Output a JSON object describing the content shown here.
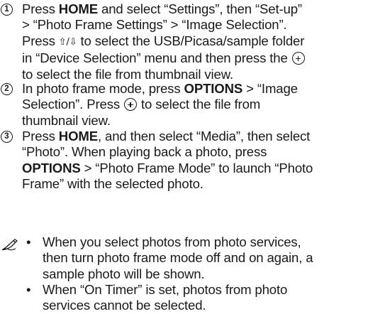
{
  "steps": [
    {
      "number": "1",
      "lines": [
        {
          "a": "Press ",
          "b": "HOME",
          "c": " and select “Settings”, then “Set-up”"
        },
        {
          "a": "> “Photo Frame Settings” > “Image Selection”."
        },
        {
          "a": "Press ",
          "arrows": "⇧/⇩",
          "c": " to select the USB/Picasa/sample folder"
        },
        {
          "a": "in “Device Selection” menu and then press the"
        },
        {
          "a": "to select the file from thumbnail view."
        }
      ]
    },
    {
      "number": "2",
      "lines": [
        {
          "a": "In photo frame mode, press ",
          "b": "OPTIONS",
          "c": " > “Image"
        },
        {
          "a": "Selection”. Press ",
          "c": " to select the file from"
        },
        {
          "a": "thumbnail view."
        }
      ]
    },
    {
      "number": "3",
      "lines": [
        {
          "a": "Press ",
          "b": "HOME",
          "c": ", and then select “Media”, then select"
        },
        {
          "a": "“Photo”. When playing back a photo, press"
        },
        {
          "b": "OPTIONS",
          "c": " > “Photo Frame Mode” to launch “Photo"
        },
        {
          "a": "Frame” with the selected photo."
        }
      ]
    }
  ],
  "notes": {
    "icon": "note-pencil-icon",
    "bullet": "•",
    "items": [
      {
        "lines": [
          "When you select photos from photo services,",
          "then turn photo frame mode off and on again, a",
          "sample photo will be shown."
        ]
      },
      {
        "lines": [
          "When “On Timer” is set, photos from photo",
          "services cannot be selected."
        ]
      }
    ]
  }
}
